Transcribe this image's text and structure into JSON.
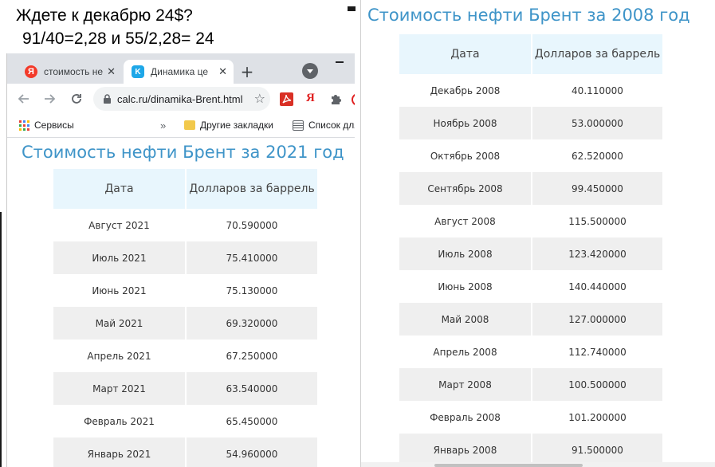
{
  "captions": {
    "line1": "Ждете к декабрю 24$?",
    "line2": "91/40=2,28 и 55/2,28= 24"
  },
  "browser": {
    "tabs": [
      {
        "label": "стоимость не",
        "favicon": "Я",
        "active": false
      },
      {
        "label": "Динамика це",
        "favicon": "K",
        "active": true
      }
    ],
    "new_tab_symbol": "+",
    "url": "calc.ru/dinamika-Brent.html",
    "yandex_ext": "Я",
    "bookmarks": {
      "apps": "Сервисы",
      "chevron": "»",
      "other": "Другие закладки",
      "reading": "Список для чтения"
    }
  },
  "left_page": {
    "title": "Стоимость нефти Брент за 2021 год",
    "headers": [
      "Дата",
      "Долларов за баррель"
    ],
    "rows": [
      {
        "date": "Август 2021",
        "price": "70.590000"
      },
      {
        "date": "Июль 2021",
        "price": "75.410000"
      },
      {
        "date": "Июнь 2021",
        "price": "75.130000"
      },
      {
        "date": "Май 2021",
        "price": "69.320000"
      },
      {
        "date": "Апрель 2021",
        "price": "67.250000"
      },
      {
        "date": "Март 2021",
        "price": "63.540000"
      },
      {
        "date": "Февраль 2021",
        "price": "65.450000"
      },
      {
        "date": "Январь 2021",
        "price": "54.960000"
      }
    ]
  },
  "right_page": {
    "title": "Стоимость нефти Брент за 2008 год",
    "headers": [
      "Дата",
      "Долларов за баррель"
    ],
    "rows": [
      {
        "date": "Декабрь 2008",
        "price": "40.110000"
      },
      {
        "date": "Ноябрь 2008",
        "price": "53.000000"
      },
      {
        "date": "Октябрь 2008",
        "price": "62.520000"
      },
      {
        "date": "Сентябрь 2008",
        "price": "99.450000"
      },
      {
        "date": "Август 2008",
        "price": "115.500000"
      },
      {
        "date": "Июль 2008",
        "price": "123.420000"
      },
      {
        "date": "Июнь 2008",
        "price": "140.440000"
      },
      {
        "date": "Май 2008",
        "price": "127.000000"
      },
      {
        "date": "Апрель 2008",
        "price": "112.740000"
      },
      {
        "date": "Март 2008",
        "price": "100.500000"
      },
      {
        "date": "Февраль 2008",
        "price": "101.200000"
      },
      {
        "date": "Январь 2008",
        "price": "91.500000"
      }
    ]
  },
  "colors": {
    "title_blue": "#3e94c8",
    "header_bg": "#e8f6fd",
    "alt_row_bg": "#efefef",
    "tab_strip": "#dee1e6"
  }
}
